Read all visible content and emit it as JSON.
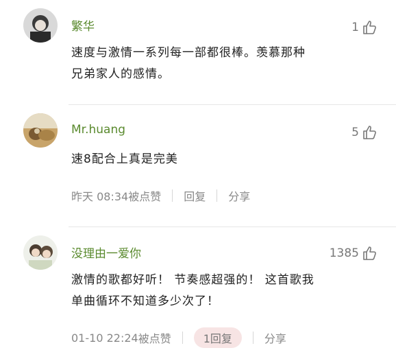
{
  "comments": [
    {
      "username": "繁华",
      "likes": "1",
      "content_lines": [
        "速度与激情一系列每一部都很棒。羡慕那种",
        "兄弟家人的感情。"
      ],
      "meta": null
    },
    {
      "username": "Mr.huang",
      "likes": "5",
      "content_lines": [
        "速8配合上真是完美"
      ],
      "meta": {
        "timestamp": "昨天 08:34",
        "liked_by": "被点赞",
        "reply": "回复",
        "share": "分享"
      }
    },
    {
      "username": "没理由一爱你",
      "likes": "1385",
      "content_lines": [
        "激情的歌都好听！ 节奏感超强的！ 这首歌我",
        "单曲循环不知道多少次了！"
      ],
      "meta": {
        "timestamp": "01-10 22:24",
        "liked_by": "被点赞",
        "reply": "1回复",
        "share": "分享"
      }
    }
  ],
  "icons": {
    "like": "thumbs-up-icon"
  },
  "colors": {
    "username": "#5a8a2e",
    "reply_pill": "#f7e4e4",
    "meta_text": "#888888"
  }
}
